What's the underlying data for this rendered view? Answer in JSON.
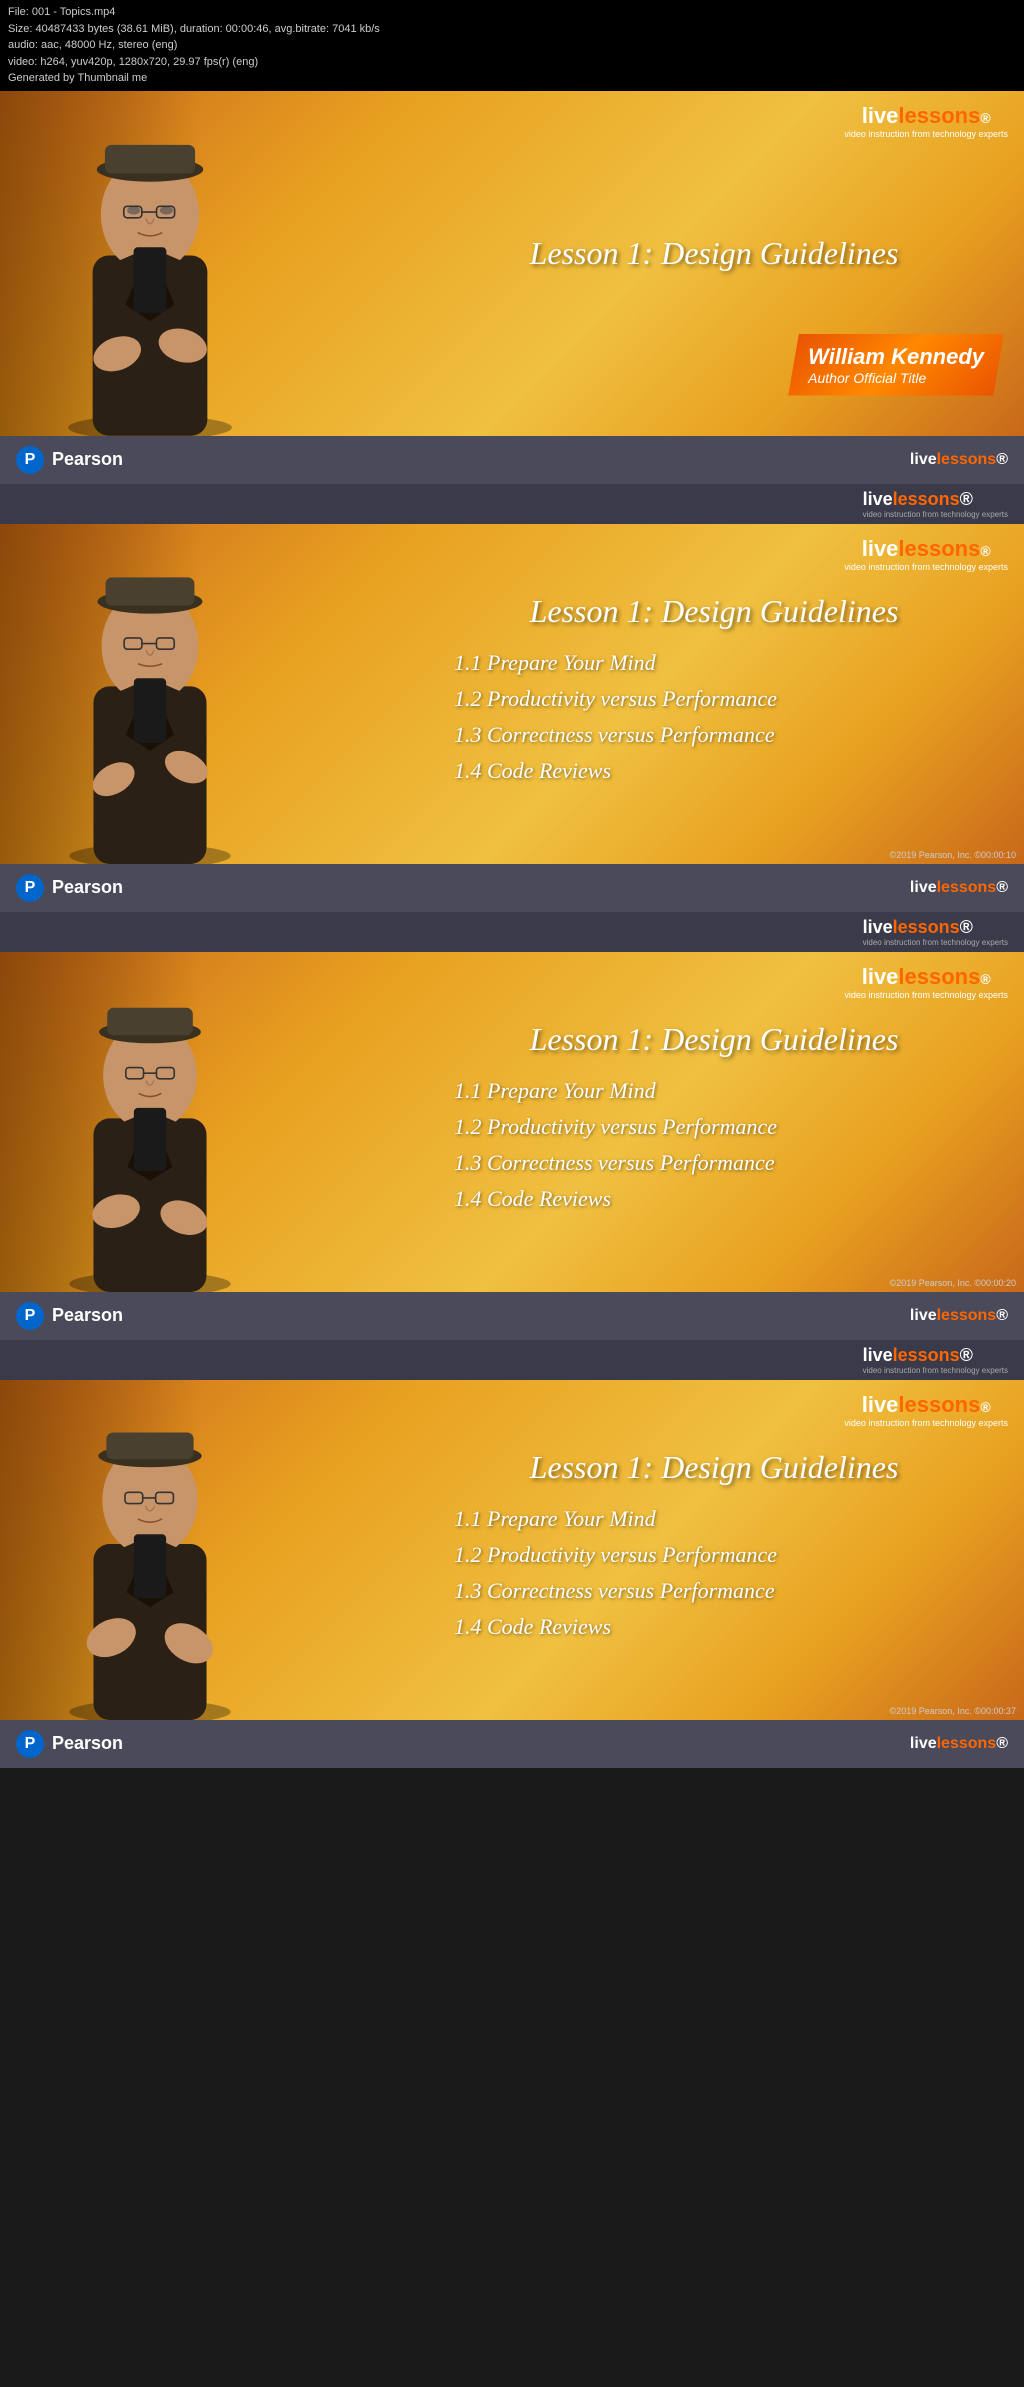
{
  "file_info": {
    "filename": "File: 001 - Topics.mp4",
    "size": "Size: 40487433 bytes (38.61 MiB), duration: 00:00:46, avg.bitrate: 7041 kb/s",
    "audio": "audio: aac, 48000 Hz, stereo (eng)",
    "video": "video: h264, yuv420p, 1280x720, 29.97 fps(r) (eng)",
    "generated": "Generated by Thumbnail me"
  },
  "panels": [
    {
      "id": "panel-1",
      "lesson_title": "Lesson 1: Design Guidelines",
      "show_name": true,
      "author_name": "William Kennedy",
      "author_title": "Author Official Title",
      "timestamp": null,
      "topics": []
    },
    {
      "id": "panel-2",
      "lesson_title": "Lesson 1: Design Guidelines",
      "show_name": false,
      "timestamp": "©00:00:10",
      "topics": [
        "1.1  Prepare Your Mind",
        "1.2  Productivity versus Performance",
        "1.3  Correctness versus Performance",
        "1.4  Code Reviews"
      ]
    },
    {
      "id": "panel-3",
      "lesson_title": "Lesson 1: Design Guidelines",
      "show_name": false,
      "timestamp": "©00:00:20",
      "topics": [
        "1.1  Prepare Your Mind",
        "1.2  Productivity versus Performance",
        "1.3  Correctness versus Performance",
        "1.4  Code Reviews"
      ]
    },
    {
      "id": "panel-4",
      "lesson_title": "Lesson 1: Design Guidelines",
      "show_name": false,
      "timestamp": "©00:00:37",
      "topics": [
        "1.1  Prepare Your Mind",
        "1.2  Productivity versus Performance",
        "1.3  Correctness versus Performance",
        "1.4  Code Reviews"
      ]
    }
  ],
  "brand": {
    "live": "live",
    "lessons": "lessons",
    "circle_r": "®",
    "subtitle": "video instruction from technology experts",
    "copyright_year": "©2019 Pearson, Inc.",
    "pearson": "Pearson"
  },
  "colors": {
    "orange_accent": "#ff6600",
    "footer_bg": "#4a4a5a",
    "small_bar_bg": "#3a3a4a",
    "video_bg_start": "#c8681a",
    "video_bg_mid": "#e8a020",
    "video_bg_end": "#f0c040"
  }
}
